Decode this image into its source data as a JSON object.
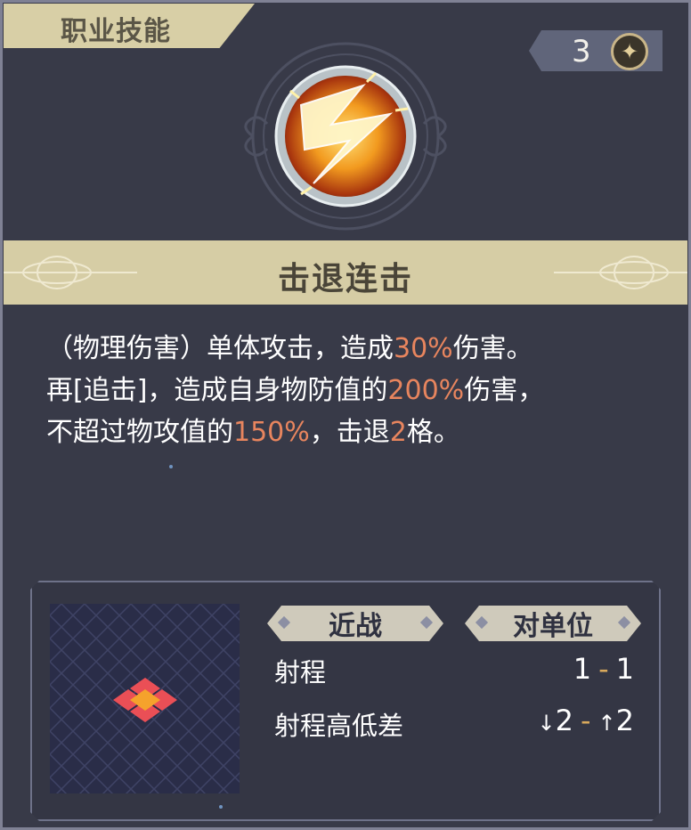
{
  "header": {
    "tab_label": "职业技能"
  },
  "cost": {
    "value": "3",
    "icon": "star-sparkle-icon"
  },
  "skill": {
    "icon": "lightning-strike-icon",
    "name": "击退连击",
    "description": {
      "line1": {
        "a": "（物理伤害）单体攻击，造成",
        "b": "30%",
        "c": "伤害。"
      },
      "line2": {
        "a": "再[追击]，造成自身物防值的",
        "b": "200%",
        "c": "伤害，"
      },
      "line3": {
        "a": "不超过物攻值的",
        "b": "150%",
        "c": "，击退",
        "d": "2",
        "e": "格。"
      }
    }
  },
  "stats": {
    "tag_melee": "近战",
    "tag_target": "对单位",
    "range_label": "射程",
    "range_min": "1",
    "range_max": "1",
    "height_label": "射程高低差",
    "height_down": "2",
    "height_up": "2",
    "range_separator": "-",
    "down_arrow_icon": "↓",
    "up_arrow_icon": "↑"
  },
  "colors": {
    "highlight": "#e8855e",
    "panel": "#383a48",
    "banner": "#d6cda5"
  }
}
